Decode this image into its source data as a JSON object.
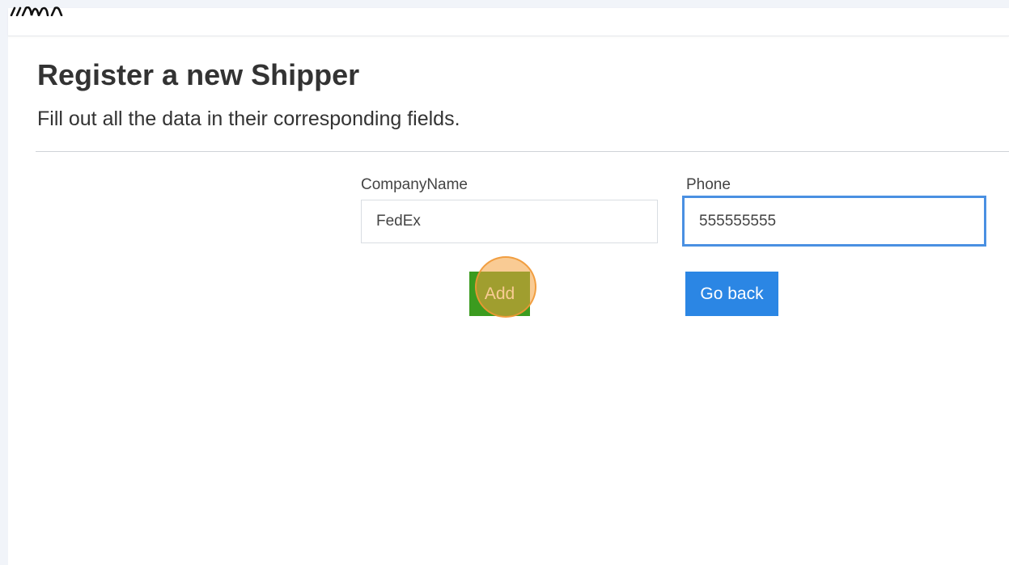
{
  "header": {
    "logo_name": "brand-logo"
  },
  "page": {
    "title": "Register a new Shipper",
    "subtitle": "Fill out all the data in their corresponding fields."
  },
  "form": {
    "company_name": {
      "label": "CompanyName",
      "value": "FedEx"
    },
    "phone": {
      "label": "Phone",
      "value": "555555555"
    }
  },
  "actions": {
    "add_label": "Add",
    "go_back_label": "Go back"
  },
  "colors": {
    "add_button": "#3b9b1f",
    "go_back_button": "#2b86e4",
    "focus_ring": "#4a90e2",
    "click_indicator": "#f4a03c"
  }
}
